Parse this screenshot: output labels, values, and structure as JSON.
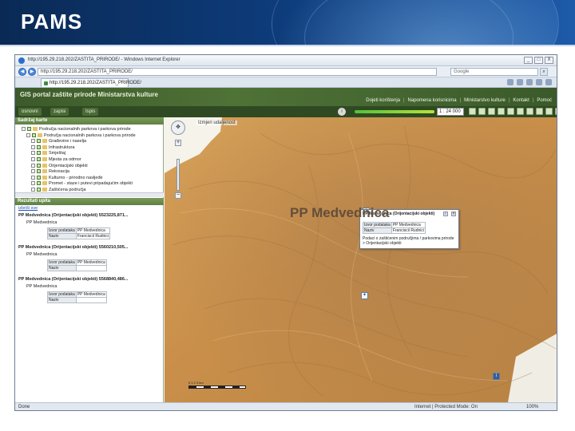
{
  "slide": {
    "title": "PAMS"
  },
  "browser": {
    "window_title": "http://195.29.218.202/ZASTITA_PRIRODE/ - Windows Internet Explorer",
    "address": "http://195.29.218.202/ZASTITA_PRIRODE/",
    "search_placeholder": "Google",
    "tab_label": "http://195.29.218.202/ZASTITA_PRIRODE/",
    "window_buttons": [
      "_",
      "□",
      "X"
    ],
    "status_done": "Done",
    "status_zone": "Internet | Protected Mode: On",
    "status_zoom": "100%"
  },
  "portal": {
    "title": "GIS portal zaštite prirode Ministarstva kulture",
    "links": [
      "Dojeti korištenja",
      "Napomena korisnicima",
      "Ministarstvo kulture",
      "Kontakt",
      "Pomoć"
    ],
    "toolbar": {
      "btn1": "osnovni",
      "btn2": "zapisi",
      "btn3": "Ispis"
    },
    "scale": "1 : 24 000"
  },
  "layers": {
    "title": "Sadržaj karte",
    "items": [
      "Područja nacionalnih parkova i parkova prirode",
      "Područja nacionalnih parkova i parkova prirode",
      "Građevine i naselja",
      "Infrastruktura",
      "Smještaj",
      "Mjesta za odmor",
      "Orijentacijski objekti",
      "Rekreacija",
      "Kulturno - prirodno nasljeđe",
      "Promet - staze i putevi pripadajućim objekti",
      "Zaštićena područja"
    ]
  },
  "results": {
    "title": "Rezultati upita",
    "clear": "izbriši sve",
    "entries": [
      {
        "head": "PP Medvednica (Orijentacijski objekti) 5523225,871...",
        "sub": "PP Medvednica",
        "k1": "Izvor podataka",
        "v1": "PP Medvednica",
        "k2": "Naziv",
        "v2": "Franciscii Rudnici"
      },
      {
        "head": "PP Medvednica (Orijentacijski objekti) 5560210,505...",
        "sub": "PP Medvednica",
        "k1": "Izvor podataka",
        "v1": "PP Medvednica",
        "k2": "Naziv",
        "v2": ""
      },
      {
        "head": "PP Medvednica (Orijentacijski objekti) 5568840,486...",
        "sub": "PP Medvednica",
        "k1": "Izvor podataka",
        "v1": "PP Medvednica",
        "k2": "Naziv",
        "v2": ""
      }
    ]
  },
  "map": {
    "label": "PP Medvednica",
    "coords": "Izmjeri udaljenost",
    "popup": {
      "head": "PP Medvednica (Orijentacijski objekti)",
      "k1": "Izvor podataka",
      "v1": "PP Medvednica",
      "k2": "Naziv",
      "v2": "Franciscii Rudnici",
      "note": "Podaci o zaštićenim područjima / parkovima prirode > Orijentacijski objekti"
    },
    "scalebar": "0 1 2 3 km"
  }
}
